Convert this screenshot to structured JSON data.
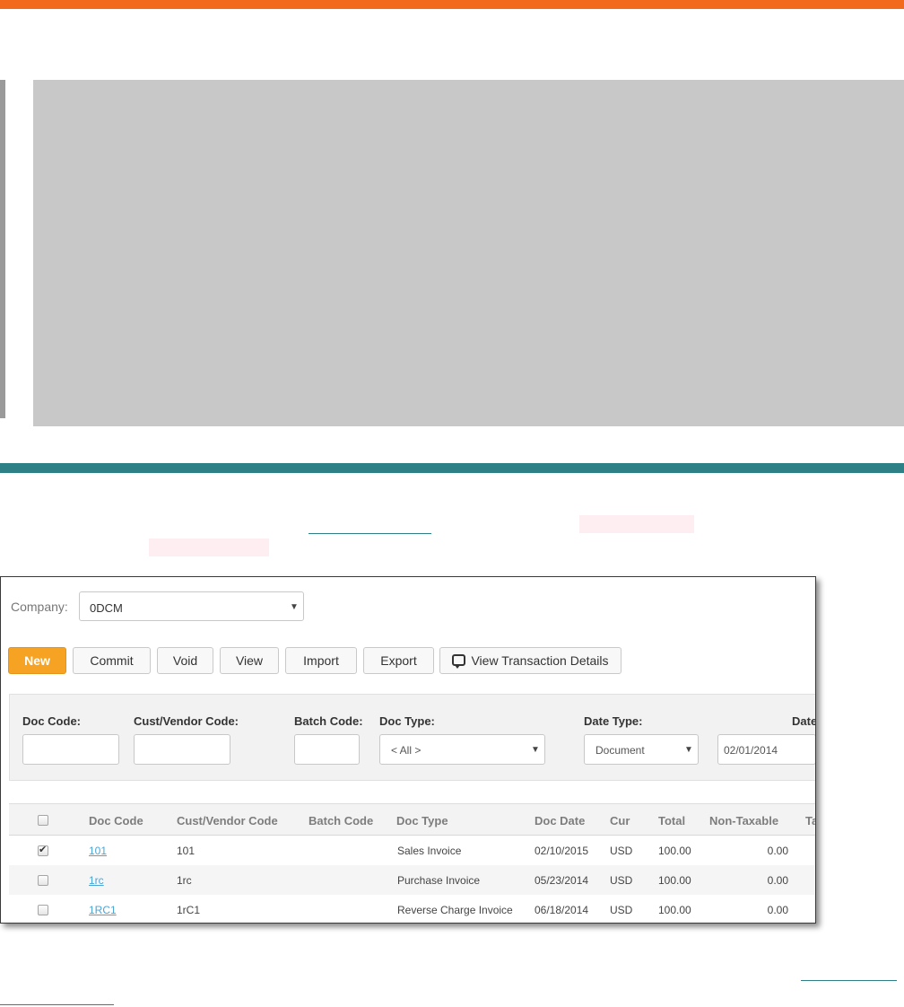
{
  "company": {
    "label": "Company:",
    "value": "0DCM"
  },
  "toolbar": {
    "new": "New",
    "commit": "Commit",
    "void": "Void",
    "view": "View",
    "import": "Import",
    "export": "Export",
    "view_details": "View Transaction Details"
  },
  "filters": {
    "doc_code_label": "Doc Code:",
    "cust_vendor_label": "Cust/Vendor Code:",
    "batch_code_label": "Batch Code:",
    "doc_type_label": "Doc Type:",
    "doc_type_value": "< All >",
    "date_type_label": "Date Type:",
    "date_type_value": "Document",
    "date_label": "Date",
    "date_value": "02/01/2014"
  },
  "table": {
    "headers": [
      "Doc Code",
      "Cust/Vendor Code",
      "Batch Code",
      "Doc Type",
      "Doc Date",
      "Cur",
      "Total",
      "Non-Taxable",
      "Ta"
    ],
    "rows": [
      {
        "checked": true,
        "doc_code": "101",
        "cust_vendor": "101",
        "batch": "",
        "doc_type": "Sales Invoice",
        "doc_date": "02/10/2015",
        "cur": "USD",
        "total": "100.00",
        "non_taxable": "0.00"
      },
      {
        "checked": false,
        "doc_code": "1rc",
        "cust_vendor": "1rc",
        "batch": "",
        "doc_type": "Purchase Invoice",
        "doc_date": "05/23/2014",
        "cur": "USD",
        "total": "100.00",
        "non_taxable": "0.00"
      },
      {
        "checked": false,
        "doc_code": "1RC1",
        "cust_vendor": "1rC1",
        "batch": "",
        "doc_type": "Reverse Charge Invoice",
        "doc_date": "06/18/2014",
        "cur": "USD",
        "total": "100.00",
        "non_taxable": "0.00"
      }
    ]
  },
  "colors": {
    "orange": "#f26b1d",
    "teal": "#2e8087",
    "button_primary": "#f6a324",
    "link": "#4aa5d8"
  },
  "icons": [
    "chat-bubble-icon",
    "chevron-down-icon",
    "checkbox"
  ]
}
